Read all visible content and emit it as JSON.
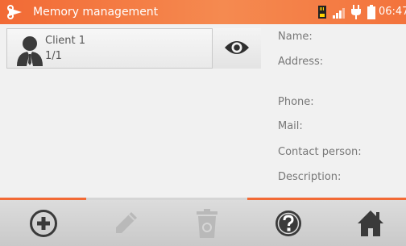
{
  "window": {
    "title": "Memory management",
    "app_icon": "scissors-logo-icon"
  },
  "status_bar": {
    "time": "06:47",
    "icons": [
      "memory-card-icon",
      "signal-icon",
      "power-plug-icon",
      "battery-icon"
    ]
  },
  "client": {
    "name": "Client 1",
    "count": "1/1",
    "avatar_icon": "person-icon",
    "view_icon": "eye-icon"
  },
  "details": {
    "name_label": "Name:",
    "address_label": "Address:",
    "phone_label": "Phone:",
    "mail_label": "Mail:",
    "contact_label": "Contact person:",
    "description_label": "Description:"
  },
  "toolbar": {
    "buttons": [
      {
        "icon": "add-icon",
        "enabled": true
      },
      {
        "icon": "edit-icon",
        "enabled": false
      },
      {
        "icon": "delete-icon",
        "enabled": false
      },
      {
        "icon": "help-icon",
        "enabled": true
      },
      {
        "icon": "home-icon",
        "enabled": true
      }
    ]
  },
  "colors": {
    "accent": "#f26a35",
    "disabled": "#b9b9b9",
    "icon": "#3a3a3a"
  }
}
